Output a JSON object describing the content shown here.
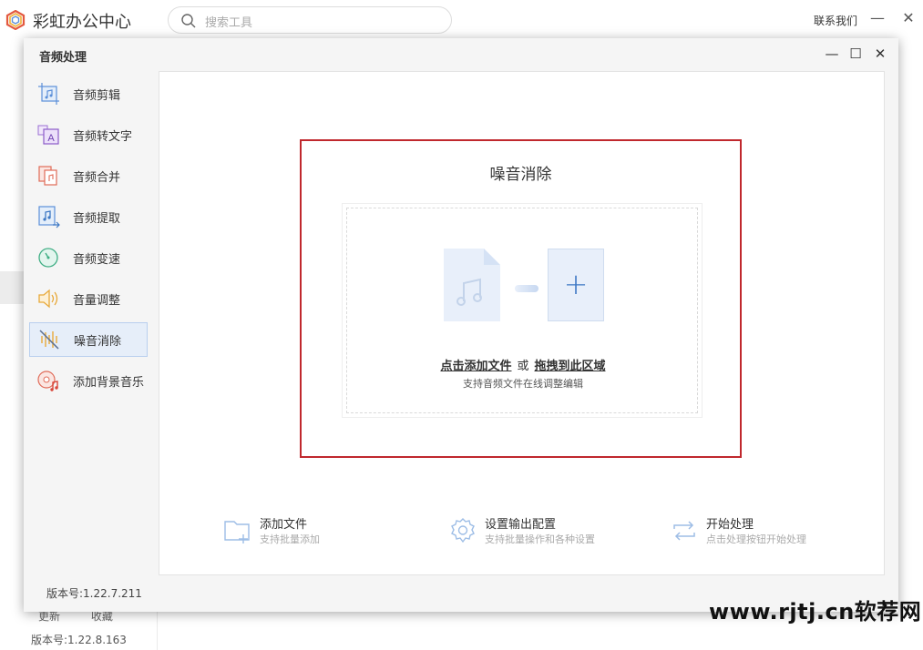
{
  "app": {
    "title": "彩虹办公中心",
    "search_placeholder": "搜索工具",
    "contact": "联系我们",
    "minimize": "—",
    "close": "✕",
    "bottom_links": [
      "更新",
      "收藏"
    ],
    "version": "版本号:1.22.8.163"
  },
  "dialog": {
    "title": "音频处理",
    "controls": {
      "minimize": "—",
      "maximize": "☐",
      "close": "✕"
    },
    "version": "版本号:1.22.7.211"
  },
  "sidebar": {
    "items": [
      {
        "label": "音频剪辑",
        "icon": "audio-cut-icon"
      },
      {
        "label": "音频转文字",
        "icon": "audio-to-text-icon"
      },
      {
        "label": "音频合并",
        "icon": "audio-merge-icon"
      },
      {
        "label": "音频提取",
        "icon": "audio-extract-icon"
      },
      {
        "label": "音频变速",
        "icon": "audio-speed-icon"
      },
      {
        "label": "音量调整",
        "icon": "volume-icon"
      },
      {
        "label": "噪音消除",
        "icon": "noise-removal-icon",
        "active": true
      },
      {
        "label": "添加背景音乐",
        "icon": "background-music-icon"
      }
    ]
  },
  "panel": {
    "title": "噪音消除",
    "click_add": "点击添加文件",
    "or": "或",
    "drag_here": "拖拽到此区域",
    "hint": "支持音频文件在线调整编辑"
  },
  "steps": [
    {
      "title": "添加文件",
      "subtitle": "支持批量添加",
      "icon": "add-folder-icon"
    },
    {
      "title": "设置输出配置",
      "subtitle": "支持批量操作和各种设置",
      "icon": "gear-icon"
    },
    {
      "title": "开始处理",
      "subtitle": "点击处理按钮开始处理",
      "icon": "refresh-icon"
    }
  ],
  "watermark": "www.rjtj.cn软荐网",
  "colors": {
    "accent": "#3d78c4",
    "highlight_border": "#c0282d",
    "active_bg": "#e6eef9"
  }
}
